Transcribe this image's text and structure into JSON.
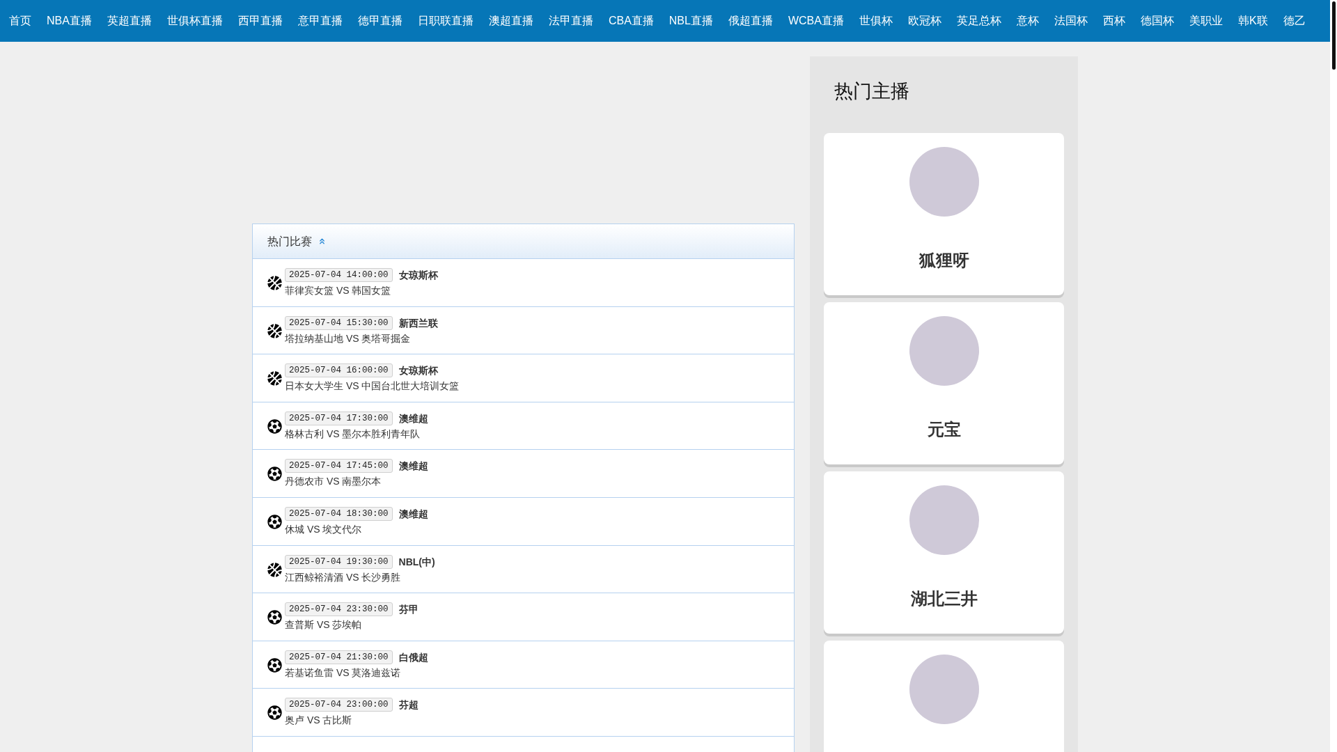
{
  "nav": {
    "items": [
      "首页",
      "NBA直播",
      "英超直播",
      "世俱杯直播",
      "西甲直播",
      "意甲直播",
      "德甲直播",
      "日职联直播",
      "澳超直播",
      "法甲直播",
      "CBA直播",
      "NBL直播",
      "俄超直播",
      "WCBA直播",
      "世俱杯",
      "欧冠杯",
      "英足总杯",
      "意杯",
      "法国杯",
      "西杯",
      "德国杯",
      "美职业",
      "韩K联",
      "德乙"
    ]
  },
  "matches": {
    "title": "热门比赛",
    "rows": [
      {
        "kind": "basketball",
        "time": "2025-07-04 14:00:00",
        "league": "女琼斯杯",
        "teams": "菲律宾女篮 VS 韩国女篮"
      },
      {
        "kind": "basketball",
        "time": "2025-07-04 15:30:00",
        "league": "新西兰联",
        "teams": "塔拉纳基山地 VS 奥塔哥掘金"
      },
      {
        "kind": "basketball",
        "time": "2025-07-04 16:00:00",
        "league": "女琼斯杯",
        "teams": "日本女大学生 VS 中国台北世大培训女篮"
      },
      {
        "kind": "football",
        "time": "2025-07-04 17:30:00",
        "league": "澳维超",
        "teams": "格林古利 VS 墨尔本胜利青年队"
      },
      {
        "kind": "football",
        "time": "2025-07-04 17:45:00",
        "league": "澳维超",
        "teams": "丹德农市 VS 南墨尔本"
      },
      {
        "kind": "football",
        "time": "2025-07-04 18:30:00",
        "league": "澳维超",
        "teams": "休城 VS 埃文代尔"
      },
      {
        "kind": "basketball",
        "time": "2025-07-04 19:30:00",
        "league": "NBL(中)",
        "teams": "江西鲸裕清酒 VS 长沙勇胜"
      },
      {
        "kind": "football",
        "time": "2025-07-04 23:30:00",
        "league": "芬甲",
        "teams": "查普斯 VS 莎埃帕"
      },
      {
        "kind": "football",
        "time": "2025-07-04 21:30:00",
        "league": "白俄超",
        "teams": "若基诺鱼雷 VS 莫洛迪兹诺"
      },
      {
        "kind": "football",
        "time": "2025-07-04 23:00:00",
        "league": "芬超",
        "teams": "奥卢 VS 古比斯"
      }
    ]
  },
  "streamers": {
    "title": "热门主播",
    "cards": [
      {
        "avatar": true,
        "name": "狐狸呀"
      },
      {
        "avatar": true,
        "name": "元宝"
      },
      {
        "avatar": true,
        "name": "湖北三井"
      },
      {
        "avatar": true
      }
    ]
  }
}
